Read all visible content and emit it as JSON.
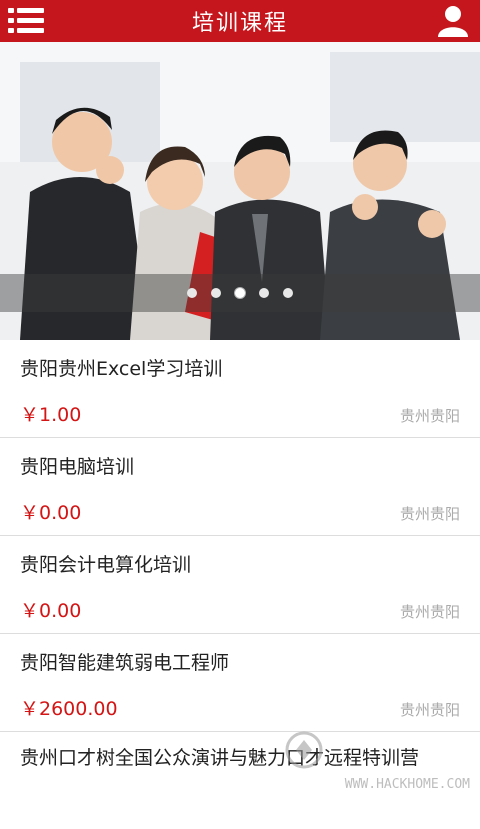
{
  "header": {
    "title": "培训课程",
    "menu_icon": "menu-icon",
    "user_icon": "user-icon",
    "color": "#c4161c"
  },
  "banner": {
    "slide_count": 5,
    "active_index": 2
  },
  "courses": [
    {
      "name": "贵阳贵州Excel学习培训",
      "price": "￥1.00",
      "location": "贵州贵阳"
    },
    {
      "name": "贵阳电脑培训",
      "price": "￥0.00",
      "location": "贵州贵阳"
    },
    {
      "name": "贵阳会计电算化培训",
      "price": "￥0.00",
      "location": "贵州贵阳"
    },
    {
      "name": "贵阳智能建筑弱电工程师",
      "price": "￥2600.00",
      "location": "贵州贵阳"
    },
    {
      "name": "贵州口才树全国公众演讲与魅力口才远程特训营"
    }
  ],
  "watermark": {
    "site": "WWW.HACKHOME.COM"
  }
}
